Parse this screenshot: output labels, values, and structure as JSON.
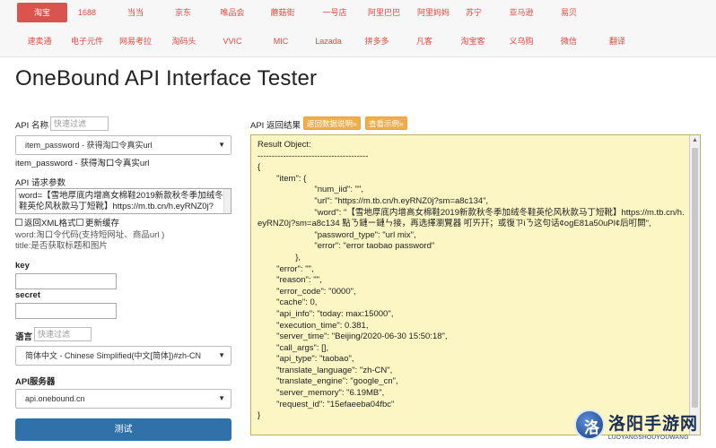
{
  "nav": {
    "row1": [
      "淘宝",
      "1688",
      "当当",
      "京东",
      "唯品会",
      "蘑菇街",
      "一号店",
      "阿里巴巴",
      "阿里妈妈",
      "苏宁",
      "亚马逊",
      "易贝"
    ],
    "row2": [
      "速卖通",
      "电子元件",
      "网易考拉",
      "淘码头",
      "VVIC",
      "MIC",
      "Lazada",
      "拼多多",
      "凡客",
      "淘宝客",
      "义乌购",
      "微信",
      "翻译"
    ]
  },
  "page_title": "OneBound API Interface Tester",
  "left": {
    "api_name_label": "API 名称",
    "api_filter_placeholder": "快速过滤",
    "api_select_value": "item_password - 获得淘口令真实url",
    "api_desc": "item_password - 获得淘口令真实url",
    "params_label": "API 请求参数",
    "params_value": "word=【雪地厚底内增高女棉鞋2019新款秋冬季加绒冬鞋英伦风秋款马丁短靴】https://m.tb.cn/h.eyRNZ0j?",
    "cb_xml": "返回XML格式",
    "cb_cache": "更新缓存",
    "hint1": "word:淘口令代码(支持短网址、商品url )",
    "hint2": "title:是否获取标题和图片",
    "key_label": "key",
    "secret_label": "secret",
    "lang_label": "语言",
    "lang_filter_placeholder": "快速过滤",
    "lang_select_value": "简体中文 - Chinese Simplified(中文[简体])#zh-CN",
    "server_label": "API服务器",
    "server_select_value": "api.onebound.cn",
    "test_button": "测试"
  },
  "right": {
    "result_label": "API 返回结果",
    "btn_doc": "返回数据说明»",
    "btn_example": "查看示例»",
    "result_text": "Result Object:\n---------------------------------------\n{\n\t\"item\": {\n\t\t\t\"num_iid\": \"\",\n\t\t\t\"url\": \"https://m.tb.cn/h.eyRNZ0j?sm=a8c134\",\n\t\t\t\"word\": \"【雪地厚底内增高女棉鞋2019新款秋冬季加绒冬鞋英伦风秋款马丁短靴】https://m.tb.cn/h.eyRNZ0j?sm=a8c134 點ㄋ鏈ー鏈ㄣ接，再选擇瀏覽器 咑ㄞ幵；或復ㄗiㄋ这句话¢ogE81a50uPl¢后咑閞\",\n\t\t\t\"password_type\": \"url mix\",\n\t\t\t\"error\": \"error taobao password\"\n\t\t},\n\t\"error\": \"\",\n\t\"reason\": \"\",\n\t\"error_code\": \"0000\",\n\t\"cache\": 0,\n\t\"api_info\": \"today: max:15000\",\n\t\"execution_time\": 0.381,\n\t\"server_time\": \"Beijing/2020-06-30 15:50:18\",\n\t\"call_args\": [],\n\t\"api_type\": \"taobao\",\n\t\"translate_language\": \"zh-CN\",\n\t\"translate_engine\": \"google_cn\",\n\t\"server_memory\": \"6.19MB\",\n\t\"request_id\": \"15efaeeba04fbc\"\n}"
  },
  "watermark": {
    "glyph": "洛",
    "title": "洛阳手游网",
    "sub": "LUOYANGSHOUYOUWANG"
  }
}
